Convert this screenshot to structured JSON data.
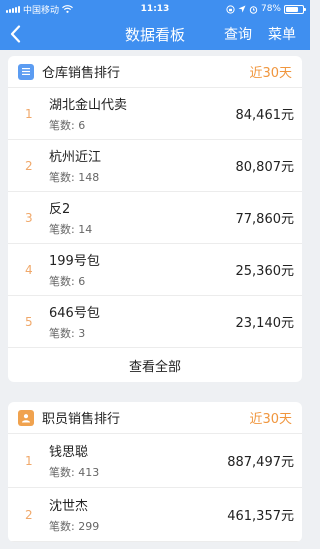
{
  "status": {
    "carrier": "中国移动",
    "time": "11:13",
    "battery": "78%",
    "battery_level": 0.78
  },
  "nav": {
    "title": "数据看板",
    "query_label": "查询",
    "menu_label": "菜单"
  },
  "warehouse": {
    "title": "仓库销售排行",
    "range": "近30天",
    "icon": "list-icon",
    "icon_color": "#5b9cf2",
    "items": [
      {
        "rank": "1",
        "name": "湖北金山代卖",
        "count_label": "笔数:",
        "count": "6",
        "amount": "84,461元"
      },
      {
        "rank": "2",
        "name": "杭州近江",
        "count_label": "笔数:",
        "count": "148",
        "amount": "80,807元"
      },
      {
        "rank": "3",
        "name": "反2",
        "count_label": "笔数:",
        "count": "14",
        "amount": "77,860元"
      },
      {
        "rank": "4",
        "name": "199号包",
        "count_label": "笔数:",
        "count": "6",
        "amount": "25,360元"
      },
      {
        "rank": "5",
        "name": "646号包",
        "count_label": "笔数:",
        "count": "3",
        "amount": "23,140元"
      }
    ],
    "view_all": "查看全部"
  },
  "staff": {
    "title": "职员销售排行",
    "range": "近30天",
    "icon": "person-icon",
    "icon_color": "#f0a24e",
    "items": [
      {
        "rank": "1",
        "name": "钱思聪",
        "count_label": "笔数:",
        "count": "413",
        "amount": "887,497元"
      },
      {
        "rank": "2",
        "name": "沈世杰",
        "count_label": "笔数:",
        "count": "299",
        "amount": "461,357元"
      }
    ]
  }
}
